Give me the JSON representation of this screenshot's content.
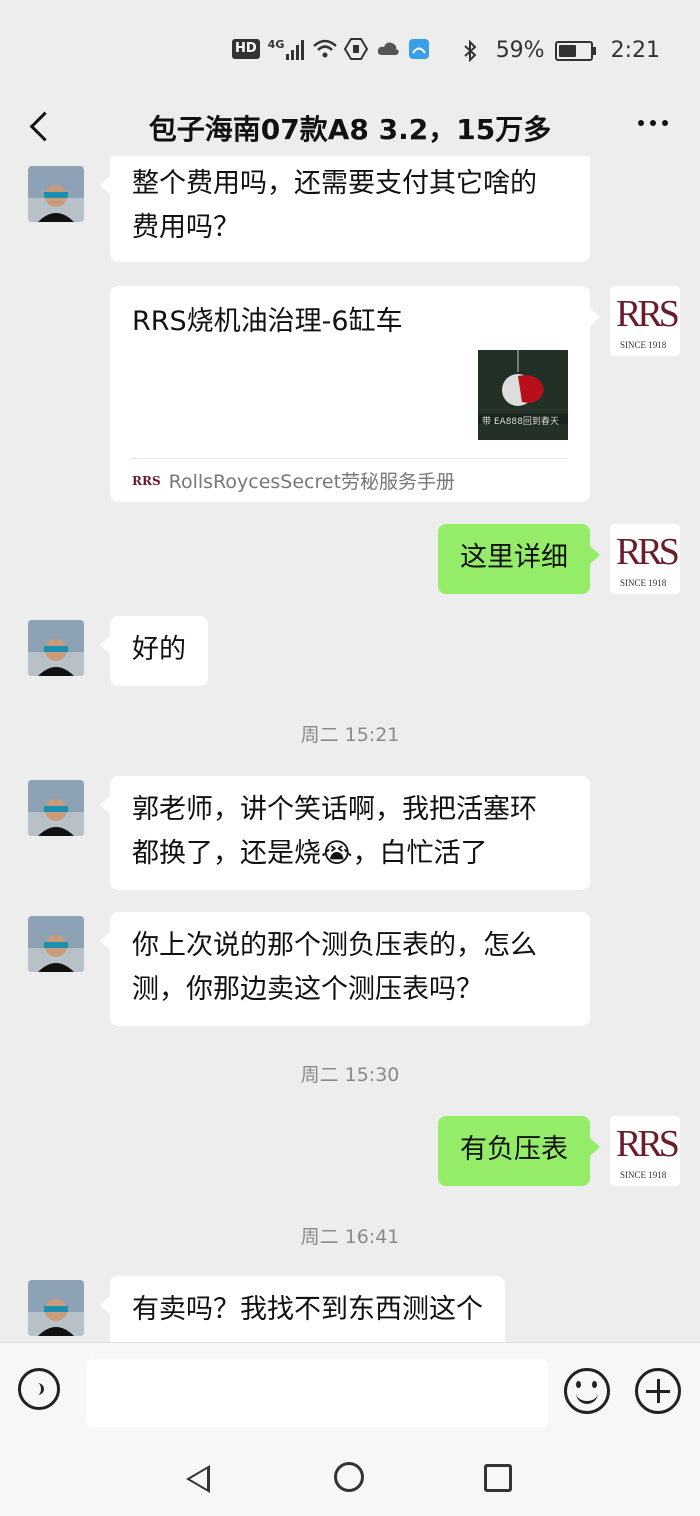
{
  "status_bar": {
    "left_icons": [
      "hd-icon",
      "4g-signal-icon",
      "wifi-icon",
      "app-notification-icon",
      "cloud-icon",
      "photo-app-icon"
    ],
    "hd_label": "HD",
    "network_label": "4G",
    "bluetooth_icon": "bluetooth-icon",
    "battery_percent": "59%",
    "battery_level": 0.59,
    "time": "2:21"
  },
  "header": {
    "title": "包子海南07款A8  3.2，15万多",
    "back_icon": "chevron-left-icon",
    "more_icon": "more-dots-icon"
  },
  "messages": [
    {
      "side": "left",
      "text_line1": "整个费用吗，还需要支付其它啥的",
      "text_line2": "费用吗？"
    },
    {
      "side": "right",
      "type": "card",
      "title": "RRS烧机油治理-6缸车",
      "thumb_caption": "带 EA888回到春天",
      "source": "RollsRoycesSecret劳秘服务手册"
    },
    {
      "side": "right",
      "text": "这里详细"
    },
    {
      "side": "left",
      "text": "好的"
    },
    {
      "type": "timestamp",
      "text": "周二 15:21"
    },
    {
      "side": "left",
      "text_line1": "郭老师，讲个笑话啊，我把活塞环",
      "text_line2_a": "都换了，还是烧",
      "emoji": "😭",
      "text_line2_b": "，白忙活了"
    },
    {
      "side": "left",
      "text_line1": "你上次说的那个测负压表的，怎么",
      "text_line2": "测，你那边卖这个测压表吗？"
    },
    {
      "type": "timestamp",
      "text": "周二 15:30"
    },
    {
      "side": "right",
      "text": "有负压表"
    },
    {
      "type": "timestamp",
      "text": "周二 16:41"
    },
    {
      "side": "left",
      "text": "有卖吗？我找不到东西测这个"
    }
  ],
  "rrs_logo": {
    "big": "RRS",
    "small": "SINCE 1918",
    "mini": "RRS"
  },
  "colors": {
    "background": "#ededed",
    "sent_bubble": "#95ec69",
    "received_bubble": "#ffffff",
    "brand": "#6b1b2c"
  },
  "input_bar": {
    "voice_icon": "voice-icon",
    "emoji_icon": "emoji-icon",
    "plus_icon": "plus-icon"
  },
  "system_nav": {
    "back_icon": "nav-back-icon",
    "home_icon": "nav-home-icon",
    "recent_icon": "nav-recent-icon"
  }
}
